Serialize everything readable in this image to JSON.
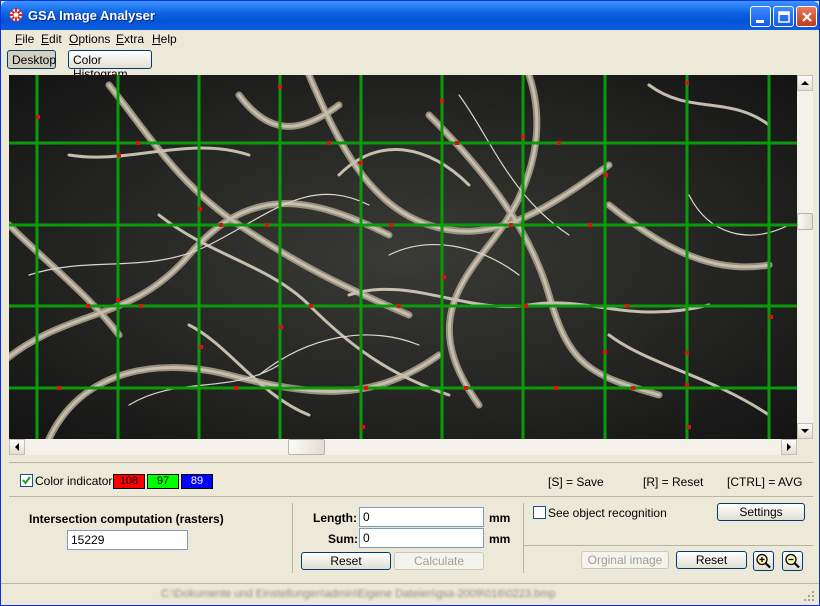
{
  "window": {
    "title": "GSA Image Analyser"
  },
  "menu": [
    {
      "label": "File",
      "u": "F",
      "rest": "ile"
    },
    {
      "label": "Edit",
      "u": "E",
      "rest": "dit"
    },
    {
      "label": "Options",
      "u": "O",
      "rest": "ptions"
    },
    {
      "label": "Extra",
      "u": "E",
      "rest": "xtra"
    },
    {
      "label": "Help",
      "u": "H",
      "rest": "elp"
    }
  ],
  "tabs": {
    "desktop": "Desktop",
    "histogram": "Color Histogram"
  },
  "color_indicator": {
    "label": "Color indicator",
    "checked": true,
    "red": "108",
    "green": "97",
    "blue": "89",
    "colors": {
      "red": "#ff0000",
      "green": "#00ff00",
      "blue": "#0000ff"
    }
  },
  "shortcuts": {
    "save": "[S] = Save",
    "reset": "[R] = Reset",
    "avg": "[CTRL] = AVG"
  },
  "intersection": {
    "title": "Intersection computation (rasters)",
    "value": "15229"
  },
  "measure": {
    "length_label": "Length:",
    "length_value": "0",
    "length_unit": "mm",
    "sum_label": "Sum:",
    "sum_value": "0",
    "sum_unit": "mm",
    "reset_label": "Reset",
    "calculate_label": "Calculate"
  },
  "recognition": {
    "checkbox_label": "See object recognition",
    "checked": false,
    "settings_label": "Settings",
    "original_label": "Orginal image",
    "reset_label": "Reset"
  },
  "status": {
    "path": "C:\\Dokumente und Einstellungen\\admin\\Eigene Dateien\\gsa-2009\\016\\0223.bmp"
  },
  "grid": {
    "color": "#0a9b0a",
    "marker_color": "#e01010"
  }
}
